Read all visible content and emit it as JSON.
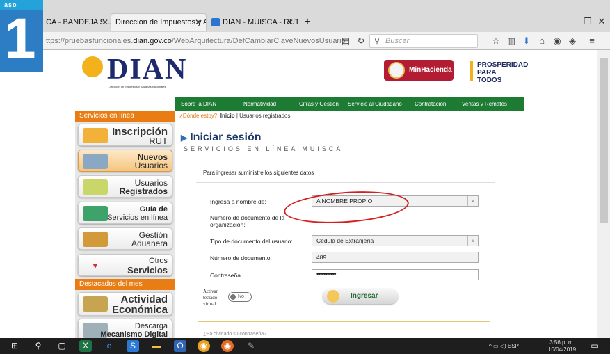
{
  "badge": {
    "top_text": "aso",
    "number": "1"
  },
  "browser": {
    "tabs": [
      {
        "label": "CA - BANDEJA S..."
      },
      {
        "label": "Dirección de Impuestos y Adu..."
      },
      {
        "label": "DIAN - MUISCA - RUT"
      }
    ],
    "url_prefix": "ttps://pruebasfuncionales.",
    "url_domain": "dian.gov.co",
    "url_path": "/WebArquitectura/DefCambiarClaveNuevosUsuarios.faces",
    "search_placeholder": "Buscar"
  },
  "header": {
    "logo_text": "DIAN",
    "logo_sub": "Dirección de Impuestos y Aduanas Nacionales",
    "minhacienda": "MinHacienda",
    "prosperidad_1": "PROSPERIDAD",
    "prosperidad_2": "PARA TODOS"
  },
  "nav": [
    "Sobre la DIAN",
    "Normatividad",
    "Cifras y Gestión",
    "Servicio al Ciudadano",
    "Contratación",
    "Ventas y Remates"
  ],
  "sidebar": {
    "section1": "Servicios en línea",
    "section2": "Destacados del mes",
    "items": [
      {
        "line1": "Inscripción",
        "line2": "RUT"
      },
      {
        "line1": "Nuevos",
        "line2": "Usuarios"
      },
      {
        "line1": "Usuarios",
        "line2": "Registrados"
      },
      {
        "line1": "Guía de",
        "line2": "Servicios en línea"
      },
      {
        "line1": "Gestión",
        "line2": "Aduanera"
      },
      {
        "line1": "Otros",
        "line2": "Servicios"
      },
      {
        "line1": "Actividad",
        "line2": "Económica"
      },
      {
        "line1": "Descarga",
        "line2": "Mecanismo Digital"
      }
    ]
  },
  "breadcrumb": {
    "question": "¿Dónde estoy?:",
    "home": "Inicio",
    "sep": " | ",
    "current": "Usuarios registrados"
  },
  "login": {
    "title": "Iniciar sesión",
    "subtitle": "SERVICIOS EN LÍNEA MUISCA",
    "intro": "Para ingresar suministre los siguientes datos",
    "fields": {
      "nombre_label": "Ingresa a nombre de:",
      "nombre_value": "A NOMBRE PROPIO",
      "org_label_1": "Número de documento de la",
      "org_label_2": "organización:",
      "tipo_label": "Tipo de documento del usuario:",
      "tipo_value": "Cédula de Extranjería",
      "numero_label": "Número de documento:",
      "numero_value": "489",
      "pass_label": "Contraseña",
      "pass_value": "•••••••••••"
    },
    "keyboard_label_1": "Activar",
    "keyboard_label_2": "teclado",
    "keyboard_label_3": "virtual",
    "toggle": "No",
    "submit": "Ingresar",
    "forgot": "¿Ha olvidado su contraseña?"
  },
  "taskbar": {
    "lang": "ESP",
    "time": "3:56 p. m.",
    "date": "10/04/2019"
  },
  "colors": {
    "dian_green": "#1e7b34",
    "orange": "#e97c13",
    "dian_blue": "#1d2a6d",
    "annotation_red": "#d42020"
  }
}
